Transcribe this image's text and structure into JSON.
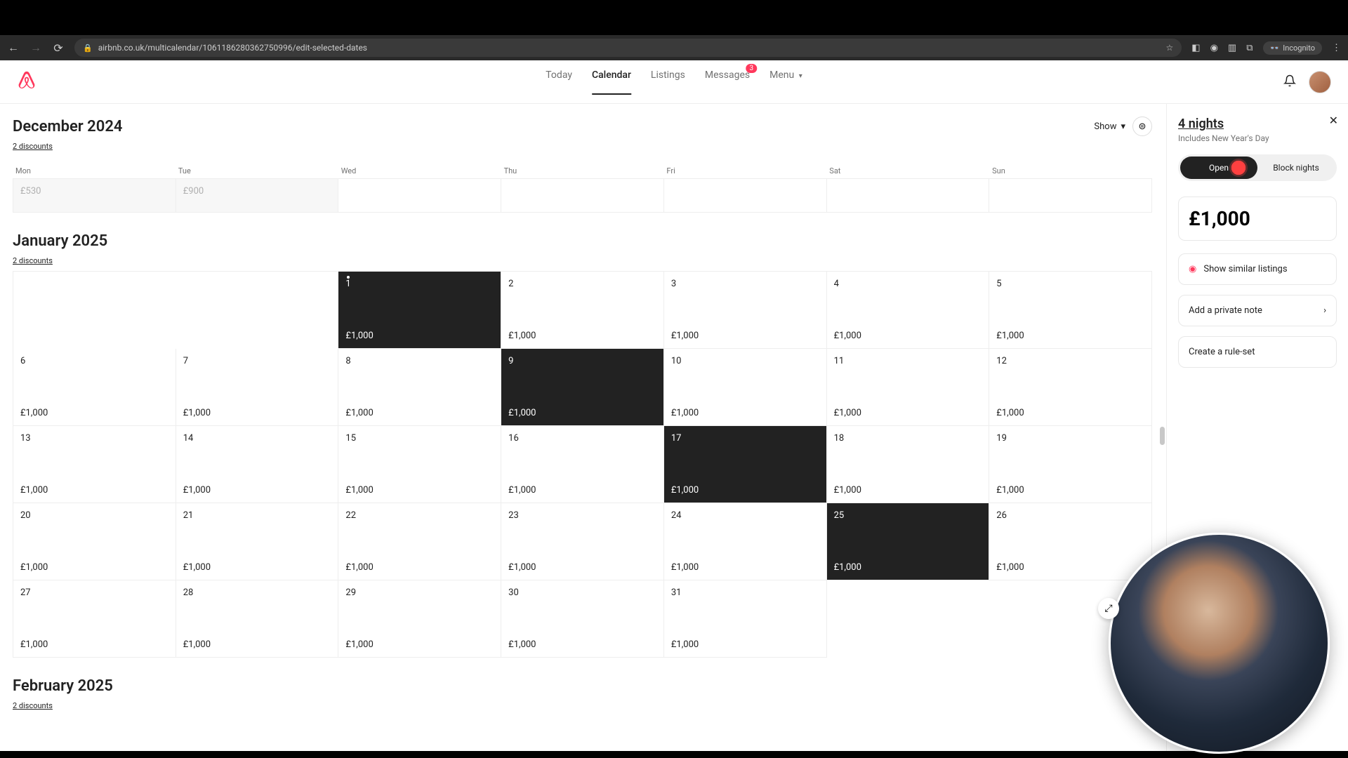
{
  "browser": {
    "url": "airbnb.co.uk/multicalendar/1061186280362750996/edit-selected-dates",
    "incognito_label": "Incognito"
  },
  "nav": {
    "today": "Today",
    "calendar": "Calendar",
    "listings": "Listings",
    "messages": "Messages",
    "messages_badge": "3",
    "menu": "Menu"
  },
  "calendar_controls": {
    "show": "Show"
  },
  "weekdays": [
    "Mon",
    "Tue",
    "Wed",
    "Thu",
    "Fri",
    "Sat",
    "Sun"
  ],
  "months": {
    "dec": {
      "title": "December 2024",
      "discounts": "2 discounts",
      "tail": [
        {
          "day": "",
          "price": "£530"
        },
        {
          "day": "",
          "price": "£900"
        }
      ]
    },
    "jan": {
      "title": "January 2025",
      "discounts": "2 discounts",
      "cells": [
        {
          "blank": true
        },
        {
          "blank": true
        },
        {
          "d": "1",
          "p": "£1,000",
          "sel": true,
          "dot": true
        },
        {
          "d": "2",
          "p": "£1,000"
        },
        {
          "d": "3",
          "p": "£1,000"
        },
        {
          "d": "4",
          "p": "£1,000"
        },
        {
          "d": "5",
          "p": "£1,000"
        },
        {
          "d": "6",
          "p": "£1,000"
        },
        {
          "d": "7",
          "p": "£1,000"
        },
        {
          "d": "8",
          "p": "£1,000"
        },
        {
          "d": "9",
          "p": "£1,000",
          "sel": true
        },
        {
          "d": "10",
          "p": "£1,000"
        },
        {
          "d": "11",
          "p": "£1,000"
        },
        {
          "d": "12",
          "p": "£1,000"
        },
        {
          "d": "13",
          "p": "£1,000"
        },
        {
          "d": "14",
          "p": "£1,000"
        },
        {
          "d": "15",
          "p": "£1,000"
        },
        {
          "d": "16",
          "p": "£1,000"
        },
        {
          "d": "17",
          "p": "£1,000",
          "sel": true
        },
        {
          "d": "18",
          "p": "£1,000"
        },
        {
          "d": "19",
          "p": "£1,000"
        },
        {
          "d": "20",
          "p": "£1,000"
        },
        {
          "d": "21",
          "p": "£1,000"
        },
        {
          "d": "22",
          "p": "£1,000"
        },
        {
          "d": "23",
          "p": "£1,000"
        },
        {
          "d": "24",
          "p": "£1,000"
        },
        {
          "d": "25",
          "p": "£1,000",
          "sel": true
        },
        {
          "d": "26",
          "p": "£1,000"
        },
        {
          "d": "27",
          "p": "£1,000"
        },
        {
          "d": "28",
          "p": "£1,000"
        },
        {
          "d": "29",
          "p": "£1,000"
        },
        {
          "d": "30",
          "p": "£1,000"
        },
        {
          "d": "31",
          "p": "£1,000"
        },
        {
          "blank": true
        },
        {
          "blank": true
        }
      ]
    },
    "feb": {
      "title": "February 2025",
      "discounts": "2 discounts"
    }
  },
  "sidebar": {
    "title": "4 nights",
    "subtitle": "Includes New Year's Day",
    "toggle_open": "Open",
    "toggle_block": "Block nights",
    "price": "£1,000",
    "similar": "Show similar listings",
    "private_note": "Add a private note",
    "rule_set": "Create a rule-set"
  }
}
